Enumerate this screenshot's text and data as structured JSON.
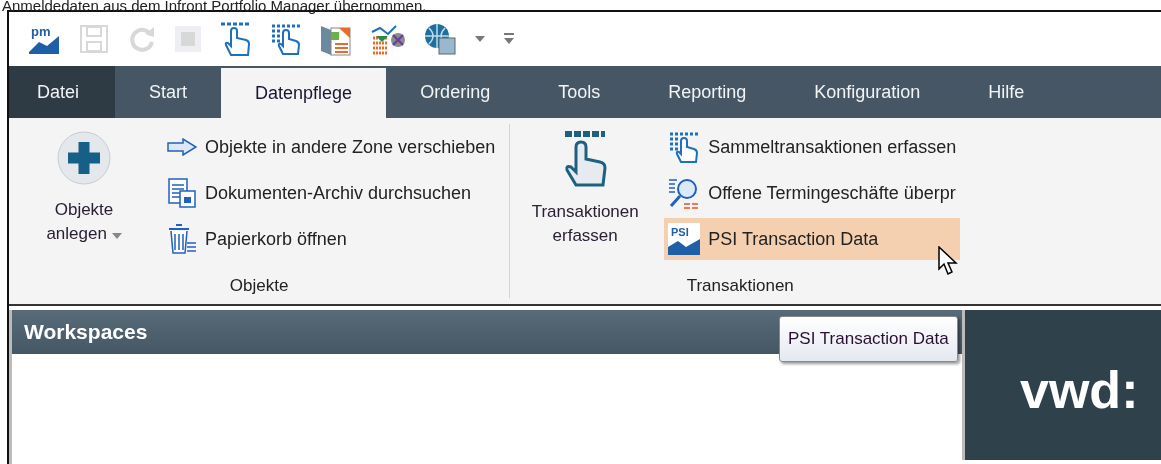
{
  "caption": "Anmeldedaten aus dem Infront Portfolio Manager übernommen.",
  "quick_access": [
    {
      "kind": "logo",
      "text": "pm",
      "disabled": false
    },
    {
      "kind": "save",
      "disabled": true
    },
    {
      "kind": "redo",
      "disabled": true
    },
    {
      "kind": "stop",
      "disabled": true
    },
    {
      "kind": "hand",
      "disabled": false
    },
    {
      "kind": "hand-grid",
      "disabled": false
    },
    {
      "kind": "report",
      "disabled": false
    },
    {
      "kind": "chart",
      "disabled": false
    },
    {
      "kind": "globe",
      "disabled": false
    },
    {
      "kind": "dropdown",
      "disabled": false
    },
    {
      "kind": "customize",
      "disabled": false
    }
  ],
  "tabs": [
    {
      "label": "Datei",
      "kind": "file",
      "selected": false
    },
    {
      "label": "Start",
      "kind": "tab",
      "selected": false
    },
    {
      "label": "Datenpflege",
      "kind": "tab",
      "selected": true
    },
    {
      "label": "Ordering",
      "kind": "tab",
      "selected": false
    },
    {
      "label": "Tools",
      "kind": "tab",
      "selected": false
    },
    {
      "label": "Reporting",
      "kind": "tab",
      "selected": false
    },
    {
      "label": "Konfiguration",
      "kind": "tab",
      "selected": false
    },
    {
      "label": "Hilfe",
      "kind": "tab",
      "selected": false
    }
  ],
  "groups": [
    {
      "label": "Objekte",
      "large": {
        "label": "Objekte anlegen",
        "dropdown": true
      },
      "items": [
        {
          "label": "Objekte in andere Zone verschieben",
          "selected": false
        },
        {
          "label": "Dokumenten-Archiv durchsuchen",
          "selected": false
        },
        {
          "label": "Papierkorb öffnen",
          "selected": false
        }
      ]
    },
    {
      "label": "Transaktionen",
      "large": {
        "label": "Transaktionen erfassen",
        "dropdown": false
      },
      "items": [
        {
          "label": "Sammeltransaktionen erfassen",
          "selected": false
        },
        {
          "label": "Offene Termingeschäfte überpr",
          "selected": false
        },
        {
          "label": "PSI Transaction Data",
          "icon_text": "PSI",
          "selected": true
        }
      ]
    }
  ],
  "tooltip": "PSI Transaction Data",
  "workspaces": {
    "title": "Workspaces"
  },
  "brand_panel": {
    "text": "vwd:"
  }
}
